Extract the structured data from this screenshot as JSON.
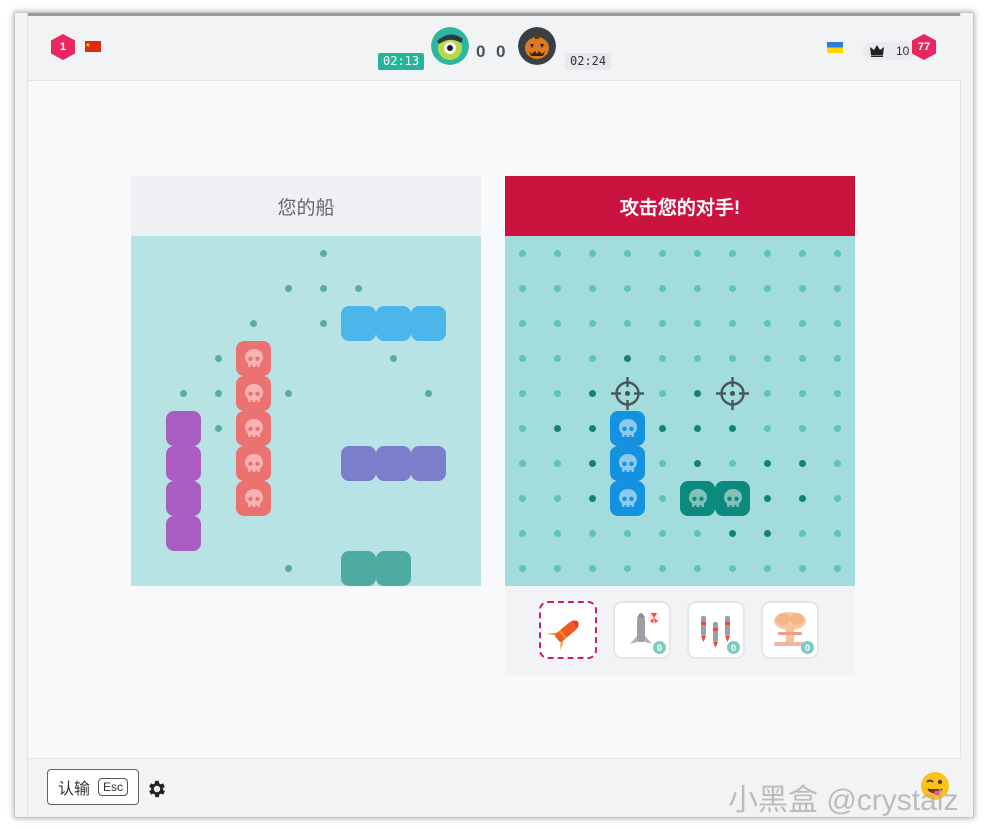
{
  "header": {
    "left_level": "1",
    "left_flag": "cn-flag-icon",
    "left_timer": "02:13",
    "left_score": "0",
    "right_score": "0",
    "right_timer": "02:24",
    "right_flag": "ua-flag-icon",
    "crown_count": "10",
    "right_level": "77",
    "colors": {
      "left_timer_bg": "#26b59a",
      "right_timer_bg": "#e6e8eb",
      "level_badge": "#e8265f"
    }
  },
  "my_board": {
    "title": "您的船",
    "background": "#b8e3e5",
    "ships": [
      {
        "name": "ship-blue",
        "color": "#4cb5ea",
        "cells": [
          [
            6,
            2
          ],
          [
            7,
            2
          ],
          [
            8,
            2
          ]
        ],
        "sunk": false
      },
      {
        "name": "ship-red",
        "color": "#ec7272",
        "cells": [
          [
            3,
            3
          ],
          [
            3,
            4
          ],
          [
            3,
            5
          ],
          [
            3,
            6
          ],
          [
            3,
            7
          ]
        ],
        "sunk": true
      },
      {
        "name": "ship-purple",
        "color": "#ab5cc1",
        "cells": [
          [
            1,
            5
          ],
          [
            1,
            6
          ],
          [
            1,
            7
          ],
          [
            1,
            8
          ]
        ],
        "sunk": false
      },
      {
        "name": "ship-indigo",
        "color": "#7b7ec8",
        "cells": [
          [
            6,
            6
          ],
          [
            7,
            6
          ],
          [
            8,
            6
          ]
        ],
        "sunk": false
      },
      {
        "name": "ship-teal",
        "color": "#4eaba2",
        "cells": [
          [
            6,
            9
          ],
          [
            7,
            9
          ]
        ],
        "sunk": false
      }
    ],
    "misses": [
      [
        5,
        0
      ],
      [
        4,
        1
      ],
      [
        5,
        1
      ],
      [
        6,
        1
      ],
      [
        3,
        2
      ],
      [
        5,
        2
      ],
      [
        2,
        3
      ],
      [
        7,
        3
      ],
      [
        1,
        4
      ],
      [
        2,
        4
      ],
      [
        4,
        4
      ],
      [
        8,
        4
      ],
      [
        2,
        5
      ],
      [
        4,
        9
      ]
    ]
  },
  "enemy_board": {
    "title": "攻击您的对手!",
    "background": "#a2dcdd",
    "dot_color": "#5fc3bd",
    "hit_dot_color": "#128279",
    "ships": [
      {
        "name": "enemy-ship-blue",
        "color": "#1492e0",
        "cells": [
          [
            3,
            5
          ],
          [
            3,
            6
          ],
          [
            3,
            7
          ]
        ],
        "sunk": true
      },
      {
        "name": "enemy-ship-teal",
        "color": "#0d8a7e",
        "cells": [
          [
            5,
            7
          ],
          [
            6,
            7
          ]
        ],
        "sunk": true
      }
    ],
    "targets": [
      [
        3,
        4
      ],
      [
        6,
        4
      ]
    ],
    "dark_dots": [
      [
        3,
        3
      ],
      [
        2,
        4
      ],
      [
        5,
        4
      ],
      [
        1,
        5
      ],
      [
        2,
        5
      ],
      [
        4,
        5
      ],
      [
        5,
        5
      ],
      [
        6,
        5
      ],
      [
        2,
        6
      ],
      [
        5,
        6
      ],
      [
        7,
        6
      ],
      [
        8,
        6
      ],
      [
        2,
        7
      ],
      [
        7,
        7
      ],
      [
        8,
        7
      ],
      [
        6,
        8
      ],
      [
        7,
        8
      ]
    ]
  },
  "weapons": [
    {
      "name": "missile",
      "icon": "missile-icon",
      "count": "",
      "selected": true
    },
    {
      "name": "nuke-rocket",
      "icon": "nuke-rocket-icon",
      "count": "0",
      "selected": false
    },
    {
      "name": "triple-missiles",
      "icon": "triple-missile-icon",
      "count": "0",
      "selected": false
    },
    {
      "name": "mushroom-bomb",
      "icon": "mushroom-cloud-icon",
      "count": "0",
      "selected": false
    }
  ],
  "footer": {
    "resign_label": "认输",
    "resign_key": "Esc",
    "settings_icon": "gear-icon",
    "emoji_icon": "winking-face-emoji",
    "watermark": "小黑盒 @crystalz"
  }
}
